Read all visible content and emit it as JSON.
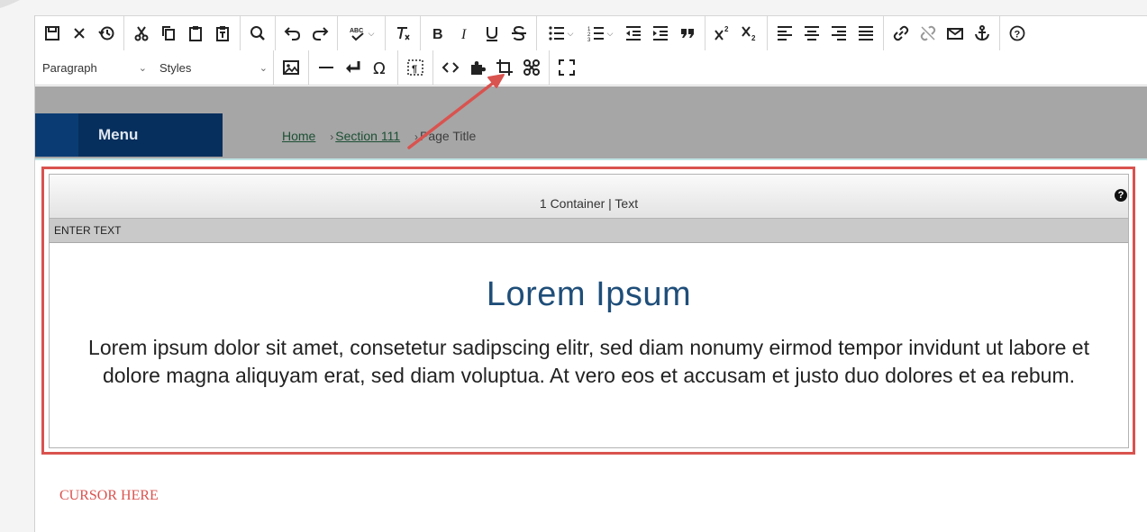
{
  "toolbar": {
    "paragraph_select": "Paragraph",
    "styles_select": "Styles"
  },
  "page_header": {
    "menu_label": "Menu",
    "breadcrumb": {
      "home": "Home",
      "section": "Section 111",
      "current": "Page Title"
    }
  },
  "container": {
    "header_label": "1 Container | Text",
    "bar_label": "ENTER TEXT",
    "title": "Lorem Ipsum",
    "body": "Lorem ipsum dolor sit amet, consetetur sadipscing elitr, sed diam nonumy eirmod tempor invidunt ut labore et dolore magna aliquyam erat, sed diam voluptua. At vero eos et accusam et justo duo dolores et ea rebum."
  },
  "cursor_note": "CURSOR HERE",
  "colors": {
    "annotation": "#d9534f",
    "menu_bg": "#062f5d",
    "title": "#1f4e79",
    "breadcrumb": "#1c4f34"
  },
  "icons": {
    "row1": [
      "save-icon",
      "close-icon",
      "history-icon",
      "cut-icon",
      "copy-icon",
      "paste-icon",
      "paste-text-icon",
      "find-icon",
      "undo-icon",
      "redo-icon",
      "spellcheck-icon",
      "clear-format-icon",
      "bold-icon",
      "italic-icon",
      "underline-icon",
      "strikethrough-icon",
      "bullet-list-icon",
      "numbered-list-icon",
      "outdent-icon",
      "indent-icon",
      "blockquote-icon",
      "superscript-icon",
      "subscript-icon",
      "align-left-icon",
      "align-center-icon",
      "align-right-icon",
      "justify-icon",
      "link-icon",
      "unlink-icon",
      "email-icon",
      "anchor-icon",
      "help-icon"
    ],
    "row2": [
      "image-icon",
      "horizontal-line-icon",
      "line-break-icon",
      "omega-icon",
      "show-blocks-icon",
      "source-code-icon",
      "plugin-icon",
      "crop-icon",
      "widget-icon",
      "fullscreen-icon"
    ]
  }
}
